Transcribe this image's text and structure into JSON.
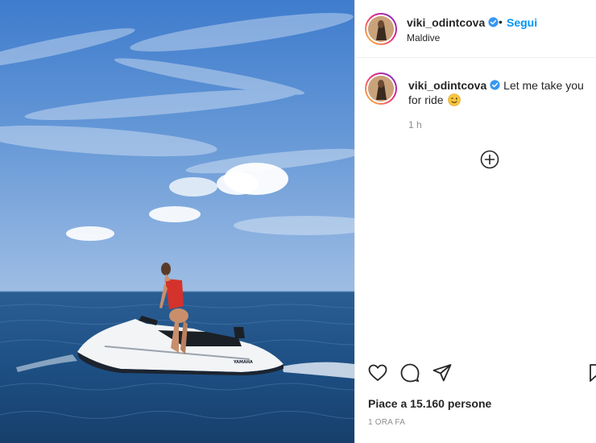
{
  "post": {
    "username": "viki_odintcova",
    "verified_icon": "verified-badge-icon",
    "separator": "•",
    "follow_label": "Segui",
    "location": "Maldive",
    "caption_text": "Let me take you for ride",
    "caption_emoji_icon": "winking-face-icon",
    "comment_time": "1 h",
    "add_comment_icon": "plus-circle-icon",
    "likes_text": "Piace a 15.160 persone",
    "posted_time": "1 ORA FA"
  },
  "colors": {
    "link_blue": "#0095f6",
    "verified_blue": "#3897f0",
    "text_primary": "#262626",
    "text_secondary": "#8e8e8e",
    "sky_top": "#3f7ccd",
    "sea": "#1d4f84"
  },
  "photo": {
    "description_alt": "",
    "jet_ski_brand": "YAMAHA"
  }
}
